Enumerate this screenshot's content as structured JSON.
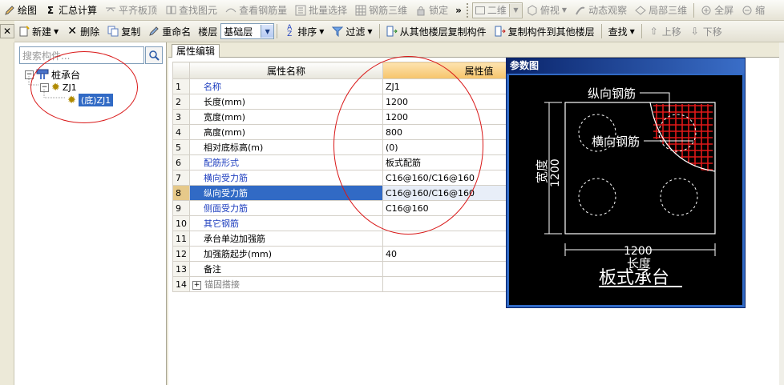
{
  "toolbar1": {
    "items": [
      {
        "label": "绘图",
        "icon": "pencil-icon",
        "enabled": true
      },
      {
        "label": "汇总计算",
        "icon": "sigma-icon",
        "enabled": true
      },
      {
        "label": "平齐板顶",
        "icon": "align-icon",
        "enabled": false
      },
      {
        "label": "查找图元",
        "icon": "find-icon",
        "enabled": false
      },
      {
        "label": "查看钢筋量",
        "icon": "view-icon",
        "enabled": false
      },
      {
        "label": "批量选择",
        "icon": "batch-icon",
        "enabled": false
      },
      {
        "label": "钢筋三维",
        "icon": "grid-icon",
        "enabled": false
      },
      {
        "label": "锁定",
        "icon": "lock-icon",
        "enabled": false
      }
    ],
    "overflow": "»",
    "view_mode": "二维",
    "view_angle": "俯视",
    "orbit": "动态观察",
    "local_3d": "局部三维",
    "fullscreen": "全屏",
    "more": "缩"
  },
  "toolbar2": {
    "new": "新建",
    "delete": "删除",
    "copy": "复制",
    "rename": "重命名",
    "floor_label": "楼层",
    "floor_value": "基础层",
    "sort": "排序",
    "filter": "过滤",
    "copy_from": "从其他楼层复制构件",
    "copy_to": "复制构件到其他楼层",
    "find": "查找",
    "move_up": "上移",
    "move_down": "下移"
  },
  "left": {
    "search_placeholder": "搜索构件...",
    "tree": {
      "root": "桩承台",
      "child": "ZJ1",
      "leaf": "(底)ZJ1"
    }
  },
  "main": {
    "tab": "属性编辑",
    "grid": {
      "col_name": "属性名称",
      "col_value": "属性值",
      "rows": [
        {
          "no": "1",
          "name": "名称",
          "value": "ZJ1",
          "style": "blue"
        },
        {
          "no": "2",
          "name": "长度(mm)",
          "value": "1200",
          "style": "normal"
        },
        {
          "no": "3",
          "name": "宽度(mm)",
          "value": "1200",
          "style": "normal"
        },
        {
          "no": "4",
          "name": "高度(mm)",
          "value": "800",
          "style": "normal"
        },
        {
          "no": "5",
          "name": "相对底标高(m)",
          "value": "(0)",
          "style": "normal"
        },
        {
          "no": "6",
          "name": "配筋形式",
          "value": "板式配筋",
          "style": "blue"
        },
        {
          "no": "7",
          "name": "横向受力筋",
          "value": "C16@160/C16@160",
          "style": "blue"
        },
        {
          "no": "8",
          "name": "纵向受力筋",
          "value": "C16@160/C16@160",
          "style": "blue",
          "selected": true
        },
        {
          "no": "9",
          "name": "侧面受力筋",
          "value": "C16@160",
          "style": "blue"
        },
        {
          "no": "10",
          "name": "其它钢筋",
          "value": "",
          "style": "blue"
        },
        {
          "no": "11",
          "name": "承台单边加强筋",
          "value": "",
          "style": "normal"
        },
        {
          "no": "12",
          "name": "加强筋起步(mm)",
          "value": "40",
          "style": "normal"
        },
        {
          "no": "13",
          "name": "备注",
          "value": "",
          "style": "normal"
        },
        {
          "no": "14",
          "name": "锚固搭接",
          "value": "",
          "style": "gray",
          "expandable": true
        }
      ]
    }
  },
  "reference": {
    "title": "参数图",
    "label_longitudinal": "纵向钢筋",
    "label_transverse": "横向钢筋",
    "label_width": "宽度",
    "label_width_value": "1200",
    "label_length_value": "1200",
    "label_length": "长度",
    "caption": "板式承台"
  },
  "colors": {
    "selection": "#316ac5",
    "annotation": "#d91818",
    "link_text": "#1f3fbf"
  }
}
